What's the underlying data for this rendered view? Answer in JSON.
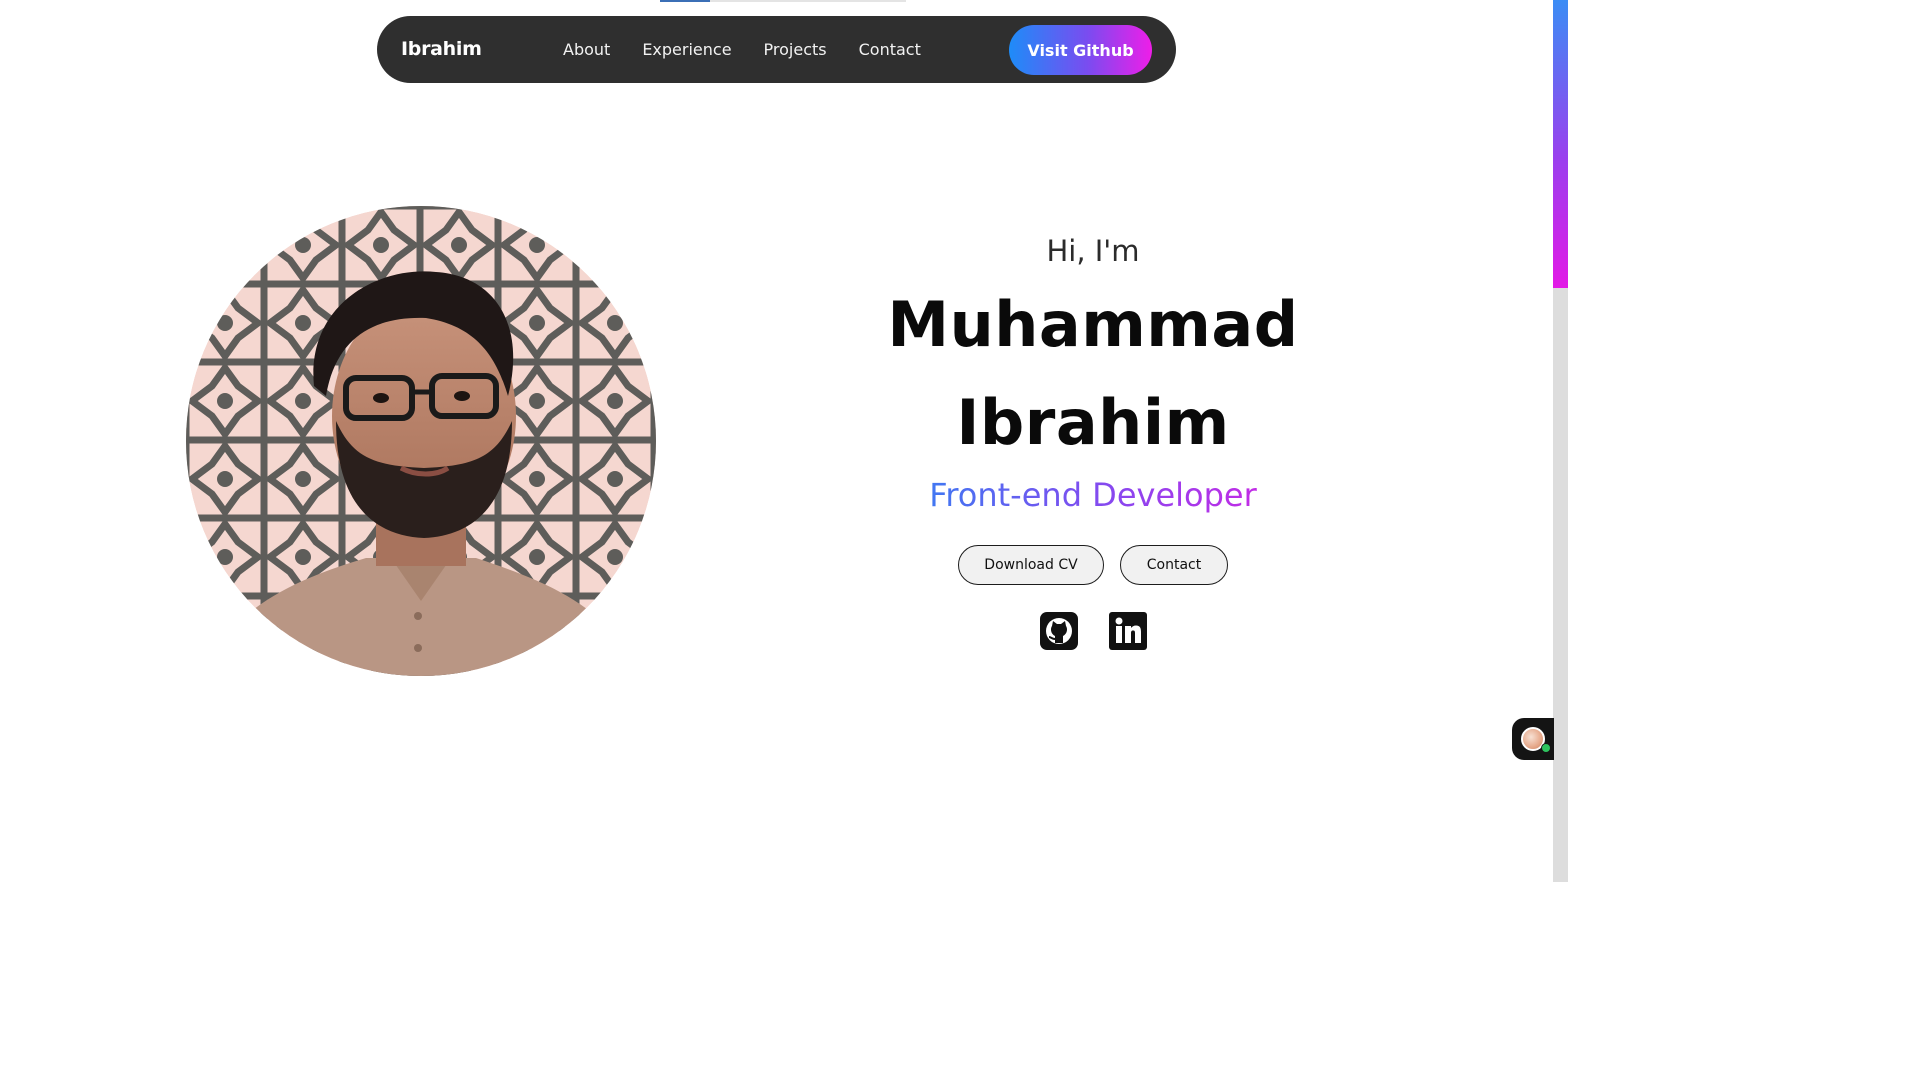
{
  "nav": {
    "brand": "Ibrahim",
    "links": [
      "About",
      "Experience",
      "Projects",
      "Contact"
    ],
    "cta_label": "Visit Github"
  },
  "hero": {
    "greeting": "Hi, I'm",
    "name_line1": "Muhammad",
    "name_line2": "Ibrahim",
    "role": "Front-end Developer",
    "buttons": {
      "download_cv": "Download CV",
      "contact": "Contact"
    },
    "social": [
      "github-icon",
      "linkedin-icon"
    ]
  },
  "colors": {
    "nav_background": "#2f2f2f",
    "gradient_start": "#1e8cf8",
    "gradient_mid": "#7a4cf0",
    "gradient_end": "#ee1ee8"
  },
  "scroll": {
    "page_progress_fraction": 0.2
  }
}
